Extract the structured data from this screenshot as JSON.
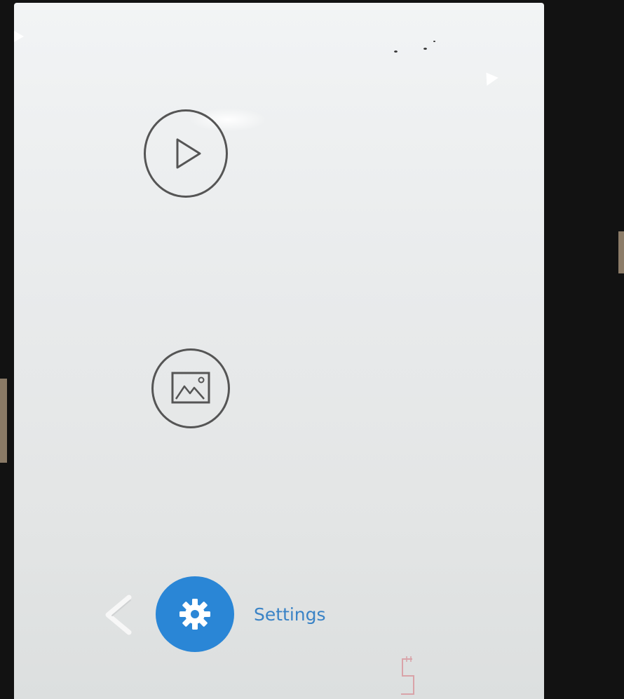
{
  "home_menu": {
    "play_button": {
      "icon": "play-icon"
    },
    "gallery_button": {
      "icon": "image-icon"
    },
    "settings": {
      "label": "Settings",
      "icon": "gear-icon",
      "accent_color": "#2a86d6",
      "label_color": "#3a83c6"
    },
    "back": {
      "icon": "chevron-left-icon"
    }
  },
  "theme": {
    "screen_background": "#eceeef",
    "outline_color": "#555555",
    "bezel_color": "#121212"
  }
}
